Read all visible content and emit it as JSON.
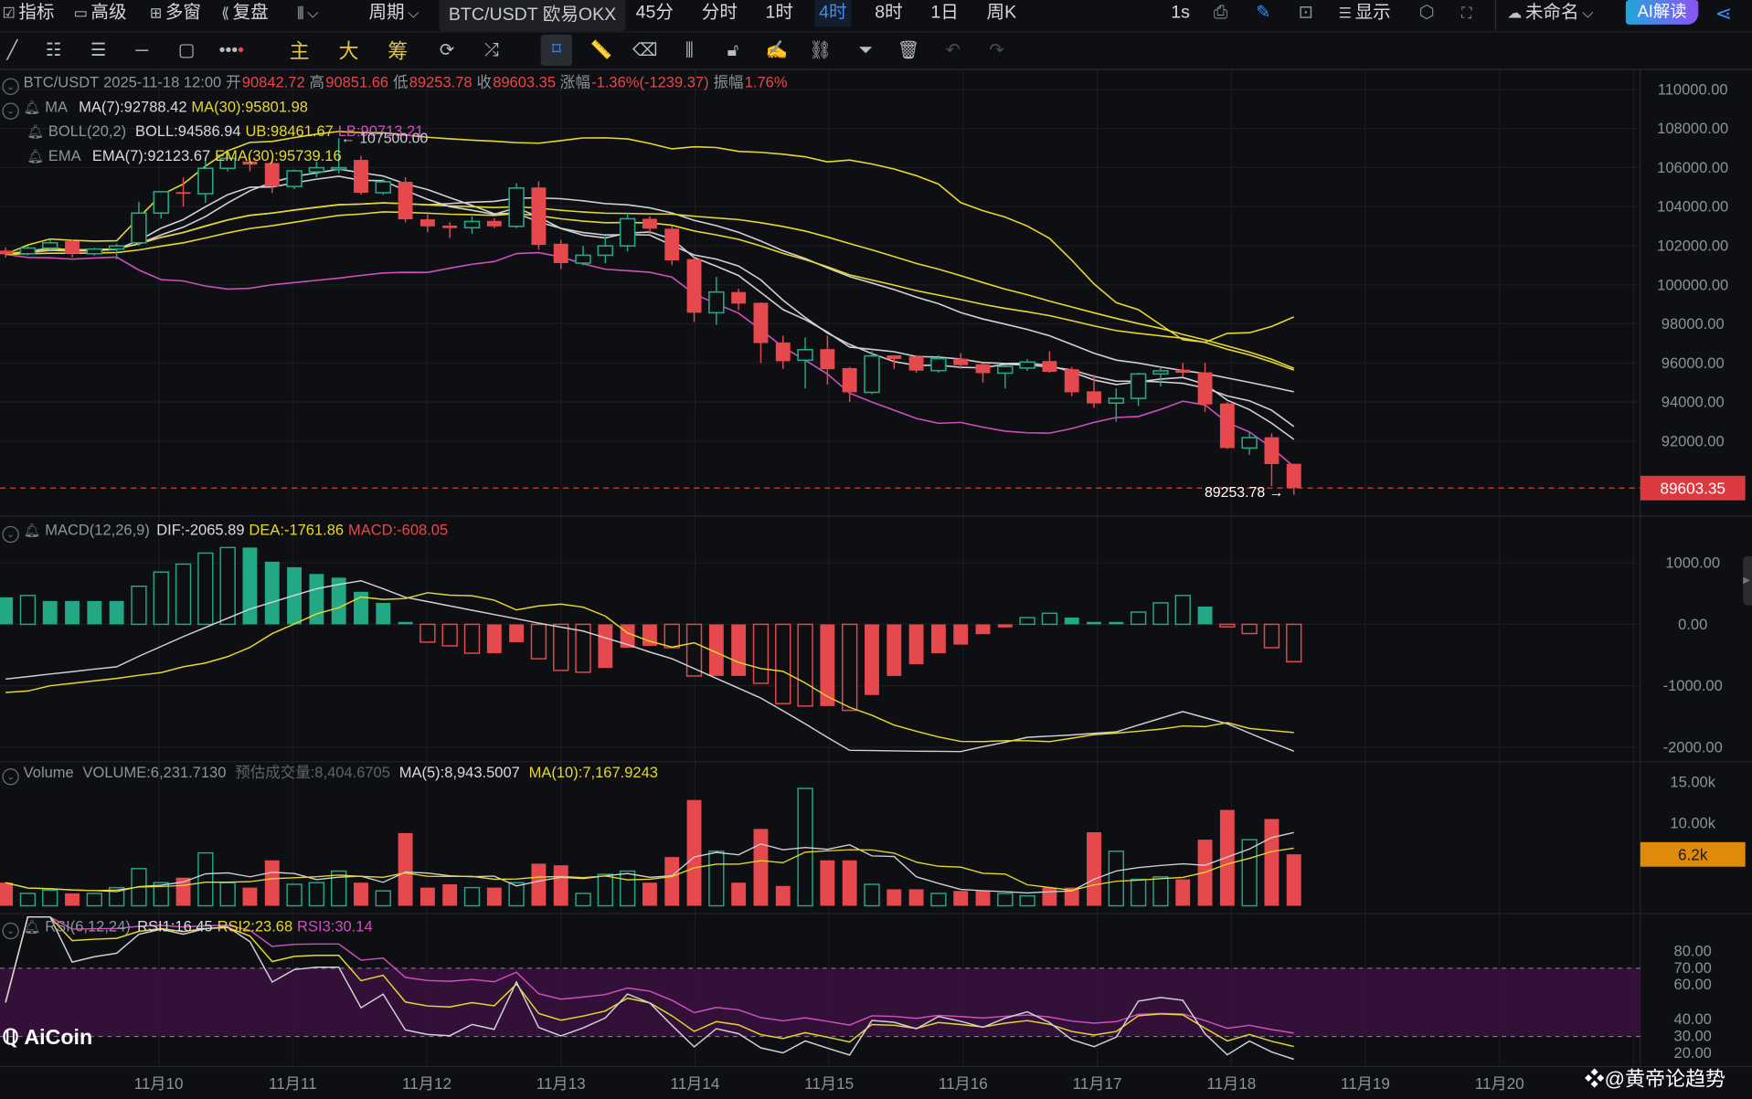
{
  "toolbar": {
    "items": [
      {
        "label": "指标",
        "icon": "indicator-icon"
      },
      {
        "label": "高级",
        "icon": "advanced-icon"
      },
      {
        "label": "多窗",
        "icon": "multi-window-icon"
      },
      {
        "label": "复盘",
        "icon": "replay-icon"
      }
    ],
    "chart_type_icon": "candlestick-chart-icon",
    "period_label": "周期",
    "symbol": "BTC/USDT 欧易OKX",
    "intervals": [
      "45分",
      "分时",
      "1时",
      "4时",
      "8时",
      "1日",
      "周K"
    ],
    "active_interval": "4时",
    "refresh": "1s",
    "display_label": "显示",
    "layout_name": "未命名",
    "ai_button": "AI解读"
  },
  "drawing_tools": {
    "main": "主",
    "big": "大",
    "chips": "筹"
  },
  "legend": {
    "main": {
      "symbol": "BTC/USDT",
      "datetime": "2025-11-18 12:00",
      "open_label": "开",
      "open": "90842.72",
      "high_label": "高",
      "high": "90851.66",
      "low_label": "低",
      "low": "89253.78",
      "close_label": "收",
      "close": "89603.35",
      "change_label": "涨幅",
      "change": "-1.36%(-1239.37)",
      "amp_label": "振幅",
      "amp": "1.76%"
    },
    "ma": {
      "name": "MA",
      "ma7": "MA(7):92788.42",
      "ma30": "MA(30):95801.98"
    },
    "boll": {
      "name": "BOLL(20,2)",
      "mid": "BOLL:94586.94",
      "ub": "UB:98461.67",
      "lb": "LB:90713.21"
    },
    "ema": {
      "name": "EMA",
      "ema7": "EMA(7):92123.67",
      "ema30": "EMA(30):95739.16"
    },
    "macd": {
      "name": "MACD(12,26,9)",
      "dif": "DIF:-2065.89",
      "dea": "DEA:-1761.86",
      "macd": "MACD:-608.05"
    },
    "volume": {
      "name": "Volume",
      "vol": "VOLUME:6,231.7130",
      "est": "预估成交量:8,404.6705",
      "ma5": "MA(5):8,943.5007",
      "ma10": "MA(10):7,167.9243"
    },
    "rsi": {
      "name": "RSI(6,12,24)",
      "rsi1": "RSI1:16.45",
      "rsi2": "RSI2:23.68",
      "rsi3": "RSI3:30.14"
    }
  },
  "annotations": {
    "high_marker": "← 107500.00",
    "low_marker": "89253.78 →",
    "last_price": "89603.35",
    "last_volume": "6.2k"
  },
  "axes": {
    "price": [
      "110000.00",
      "108000.00",
      "106000.00",
      "104000.00",
      "102000.00",
      "100000.00",
      "98000.00",
      "96000.00",
      "94000.00",
      "92000.00"
    ],
    "macd": [
      "1000.00",
      "0.00",
      "-1000.00",
      "-2000.00"
    ],
    "volume": [
      "15.00k",
      "10.00k"
    ],
    "rsi": [
      "80.00",
      "70.00",
      "60.00",
      "40.00",
      "30.00",
      "20.00"
    ],
    "time": [
      "11月10",
      "11月11",
      "11月12",
      "11月13",
      "11月14",
      "11月15",
      "11月16",
      "11月17",
      "11月18",
      "11月19",
      "11月20"
    ]
  },
  "colors": {
    "up": "#22a884",
    "down": "#e5484d",
    "accent": "#3d8ef0",
    "yellow": "#e6d82c",
    "pink": "#d04fc0",
    "white": "#d0d2d6",
    "rsi_band": "#3a1040",
    "volume_tag": "#e08a0b"
  },
  "watermarks": {
    "left": "AiCoin",
    "right": "@黄帝论趋势"
  },
  "chart_data": {
    "type": "candlestick",
    "interval": "4时",
    "ohlc_order": [
      "open",
      "high",
      "low",
      "close"
    ],
    "ohlc": [
      [
        101750,
        101900,
        101400,
        101560
      ],
      [
        101590,
        102000,
        101500,
        101880
      ],
      [
        101880,
        102300,
        101800,
        102150
      ],
      [
        102230,
        102300,
        101400,
        101590
      ],
      [
        101590,
        101900,
        101500,
        101830
      ],
      [
        101830,
        102100,
        101300,
        101990
      ],
      [
        102150,
        104250,
        102000,
        103670
      ],
      [
        103670,
        104800,
        103400,
        104760
      ],
      [
        104740,
        105500,
        104000,
        104660
      ],
      [
        104660,
        106400,
        104200,
        105960
      ],
      [
        105960,
        106900,
        105800,
        106470
      ],
      [
        106310,
        106500,
        105800,
        106150
      ],
      [
        106230,
        106400,
        104700,
        105030
      ],
      [
        105030,
        105900,
        104900,
        105830
      ],
      [
        105780,
        106300,
        105500,
        105990
      ],
      [
        105910,
        107500,
        105700,
        105990
      ],
      [
        106390,
        106600,
        104600,
        104710
      ],
      [
        104710,
        105400,
        104600,
        105270
      ],
      [
        105270,
        105500,
        103200,
        103350
      ],
      [
        103350,
        103600,
        102700,
        102990
      ],
      [
        103030,
        103200,
        102400,
        102900
      ],
      [
        102920,
        103500,
        102600,
        103240
      ],
      [
        103270,
        103400,
        102900,
        102990
      ],
      [
        102990,
        105200,
        102900,
        104950
      ],
      [
        104980,
        105300,
        101800,
        102040
      ],
      [
        102100,
        102300,
        100800,
        101110
      ],
      [
        101110,
        102000,
        101000,
        101510
      ],
      [
        101510,
        102500,
        101100,
        101990
      ],
      [
        101990,
        103700,
        101700,
        103380
      ],
      [
        103380,
        103500,
        102600,
        102870
      ],
      [
        102870,
        103000,
        101000,
        101250
      ],
      [
        101315,
        101400,
        98100,
        98570
      ],
      [
        98570,
        100400,
        97950,
        99630
      ],
      [
        99630,
        99800,
        98700,
        99040
      ],
      [
        99080,
        99100,
        96000,
        97020
      ],
      [
        97050,
        97400,
        95700,
        96090
      ],
      [
        96140,
        97300,
        94700,
        96680
      ],
      [
        96710,
        97400,
        94900,
        95680
      ],
      [
        95740,
        95800,
        94000,
        94500
      ],
      [
        94500,
        96600,
        94400,
        96360
      ],
      [
        96390,
        96400,
        95700,
        96200
      ],
      [
        96330,
        96400,
        95500,
        95610
      ],
      [
        95610,
        96400,
        95500,
        96220
      ],
      [
        96220,
        96500,
        95700,
        95890
      ],
      [
        95940,
        96000,
        95000,
        95480
      ],
      [
        95480,
        95900,
        94700,
        95820
      ],
      [
        95740,
        96200,
        95600,
        96050
      ],
      [
        96100,
        96600,
        95500,
        95550
      ],
      [
        95680,
        95800,
        94300,
        94500
      ],
      [
        94550,
        95400,
        93700,
        93930
      ],
      [
        93950,
        94700,
        93000,
        94190
      ],
      [
        94190,
        95500,
        93800,
        95440
      ],
      [
        95440,
        95800,
        94800,
        95600
      ],
      [
        95660,
        96000,
        95300,
        95500
      ],
      [
        95520,
        96000,
        93500,
        93880
      ],
      [
        93930,
        94000,
        91600,
        91650
      ],
      [
        91650,
        92500,
        91300,
        92180
      ],
      [
        92200,
        92400,
        89700,
        90830
      ],
      [
        90842.72,
        90851.66,
        89253.78,
        89603.35
      ]
    ],
    "volume": [
      2800,
      1500,
      1900,
      1500,
      1500,
      2200,
      4500,
      2800,
      3400,
      6400,
      2800,
      2200,
      5500,
      2600,
      2800,
      4200,
      2800,
      1800,
      8800,
      2200,
      2600,
      2200,
      2200,
      2800,
      5100,
      4900,
      1500,
      3800,
      4200,
      2800,
      5900,
      12800,
      6600,
      2800,
      9300,
      2400,
      14200,
      5500,
      5500,
      2600,
      2000,
      2000,
      1500,
      1800,
      1800,
      1500,
      1200,
      2200,
      2200,
      8900,
      6600,
      3200,
      3500,
      3200,
      8000,
      11600,
      8000,
      10500,
      6231.713
    ],
    "macd_hist": [
      440,
      470,
      380,
      380,
      380,
      380,
      620,
      850,
      980,
      1160,
      1250,
      1250,
      1020,
      930,
      820,
      760,
      530,
      350,
      40,
      -290,
      -350,
      -470,
      -470,
      -290,
      -560,
      -750,
      -780,
      -710,
      -380,
      -350,
      -380,
      -840,
      -840,
      -840,
      -960,
      -1290,
      -1330,
      -1330,
      -1400,
      -1150,
      -840,
      -650,
      -470,
      -330,
      -160,
      -50,
      110,
      180,
      110,
      40,
      40,
      200,
      350,
      470,
      290,
      -40,
      -150,
      -380,
      -608.05
    ],
    "dif": [
      -890,
      -850,
      -810,
      -770,
      -730,
      -690,
      -520,
      -360,
      -200,
      -50,
      100,
      250,
      360,
      470,
      580,
      650,
      710,
      580,
      440,
      370,
      300,
      230,
      160,
      90,
      20,
      -45,
      -110,
      -220,
      -330,
      -450,
      -560,
      -720,
      -880,
      -1040,
      -1200,
      -1410,
      -1620,
      -1840,
      -2050,
      -2055,
      -2060,
      -2065,
      -2068,
      -2070,
      -1990,
      -1920,
      -1840,
      -1820,
      -1800,
      -1775,
      -1750,
      -1640,
      -1530,
      -1420,
      -1520,
      -1620,
      -1770,
      -1920,
      -2065.89
    ],
    "price_range": [
      88000,
      111000
    ],
    "macd_range": [
      -2300,
      1400
    ],
    "volume_range": [
      0,
      16500
    ],
    "rsi_range": [
      15,
      85
    ],
    "rsi_band": [
      30,
      70
    ],
    "grid": true
  }
}
